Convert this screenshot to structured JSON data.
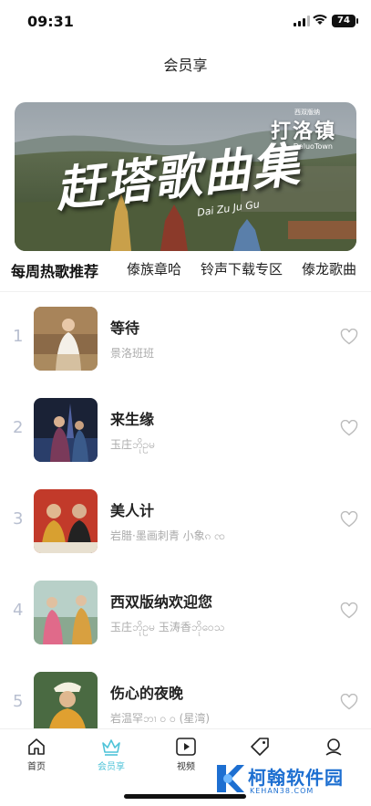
{
  "status": {
    "time": "09:31",
    "battery": "74"
  },
  "page": {
    "title": "会员享"
  },
  "banner": {
    "title": "赶塔歌曲集",
    "logo": "打洛镇",
    "logo_top": "西双版纳",
    "logo_sub": "DaluoTown",
    "script": "Dai Zu Ju Gu"
  },
  "tabs": [
    {
      "label": "每周热歌推荐",
      "active": true
    },
    {
      "label": "傣族章哈",
      "active": false
    },
    {
      "label": "铃声下载专区",
      "active": false
    },
    {
      "label": "傣龙歌曲",
      "active": false
    }
  ],
  "songs": [
    {
      "rank": "1",
      "title": "等待",
      "artist": "景洛班班"
    },
    {
      "rank": "2",
      "title": "来生缘",
      "artist": "玉庄ဘိုဥမ"
    },
    {
      "rank": "3",
      "title": "美人计",
      "artist": "岩腊·墨画刺青   小象ၵ ၸ"
    },
    {
      "rank": "4",
      "title": "西双版纳欢迎您",
      "artist": "玉庄ဘိုဥမ   玉涛香ဘိုဝေသ"
    },
    {
      "rank": "5",
      "title": "伤心的夜晚",
      "artist": "岩温罕ဘၢ ဝ ဝ (星湾)"
    }
  ],
  "nav": [
    {
      "label": "首页",
      "icon": "home-icon",
      "active": false
    },
    {
      "label": "会员享",
      "icon": "crown-icon",
      "active": true
    },
    {
      "label": "视频",
      "icon": "play-icon",
      "active": false
    },
    {
      "label": "",
      "icon": "tag-icon",
      "active": false
    },
    {
      "label": "",
      "icon": "user-icon",
      "active": false
    }
  ],
  "watermark": {
    "name": "柯翰软件园",
    "url": "KEHAN38.COM"
  },
  "colors": {
    "accent": "#4fc3d8",
    "rank": "#b8bfd0",
    "watermark": "#1d6fd1"
  }
}
